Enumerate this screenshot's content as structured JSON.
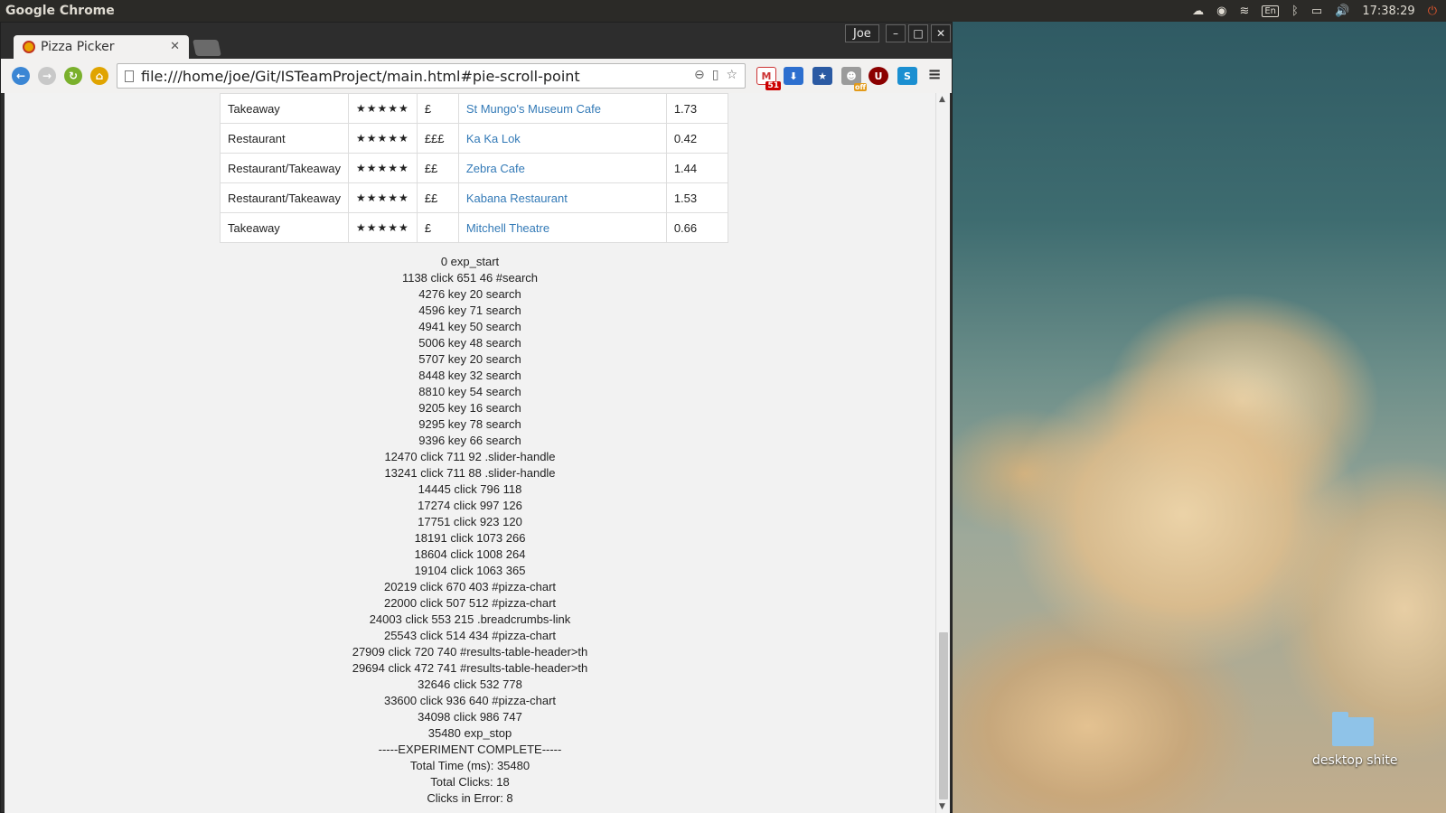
{
  "top_panel": {
    "app_name": "Google Chrome",
    "keyboard": "En",
    "clock": "17:38:29"
  },
  "browser": {
    "tab_title": "Pizza Picker",
    "profile": "Joe",
    "url": "file:///home/joe/Git/ISTeamProject/main.html#pie-scroll-point",
    "gmail_badge": "51",
    "robot_badge": "off"
  },
  "results": [
    {
      "type": "Takeaway",
      "rating": "★★★★★",
      "price": "£",
      "name": "St Mungo's Museum Cafe",
      "distance": "1.73"
    },
    {
      "type": "Restaurant",
      "rating": "★★★★★",
      "price": "£££",
      "name": "Ka Ka Lok",
      "distance": "0.42"
    },
    {
      "type": "Restaurant/Takeaway",
      "rating": "★★★★★",
      "price": "££",
      "name": "Zebra Cafe",
      "distance": "1.44"
    },
    {
      "type": "Restaurant/Takeaway",
      "rating": "★★★★★",
      "price": "££",
      "name": "Kabana Restaurant",
      "distance": "1.53"
    },
    {
      "type": "Takeaway",
      "rating": "★★★★★",
      "price": "£",
      "name": "Mitchell Theatre",
      "distance": "0.66"
    }
  ],
  "log": [
    "0 exp_start",
    "1138 click 651 46 #search",
    "4276 key 20 search",
    "4596 key 71 search",
    "4941 key 50 search",
    "5006 key 48 search",
    "5707 key 20 search",
    "8448 key 32 search",
    "8810 key 54 search",
    "9205 key 16 search",
    "9295 key 78 search",
    "9396 key 66 search",
    "12470 click 711 92 .slider-handle",
    "13241 click 711 88 .slider-handle",
    "14445 click 796 118",
    "17274 click 997 126",
    "17751 click 923 120",
    "18191 click 1073 266",
    "18604 click 1008 264",
    "19104 click 1063 365",
    "20219 click 670 403 #pizza-chart",
    "22000 click 507 512 #pizza-chart",
    "24003 click 553 215 .breadcrumbs-link",
    "25543 click 514 434 #pizza-chart",
    "27909 click 720 740 #results-table-header>th",
    "29694 click 472 741 #results-table-header>th",
    "32646 click 532 778",
    "33600 click 936 640 #pizza-chart",
    "34098 click 986 747",
    "35480 exp_stop",
    "-----EXPERIMENT COMPLETE-----",
    "Total Time (ms): 35480",
    "Total Clicks: 18",
    "Clicks in Error: 8"
  ],
  "desktop": {
    "folder_label": "desktop shite"
  }
}
